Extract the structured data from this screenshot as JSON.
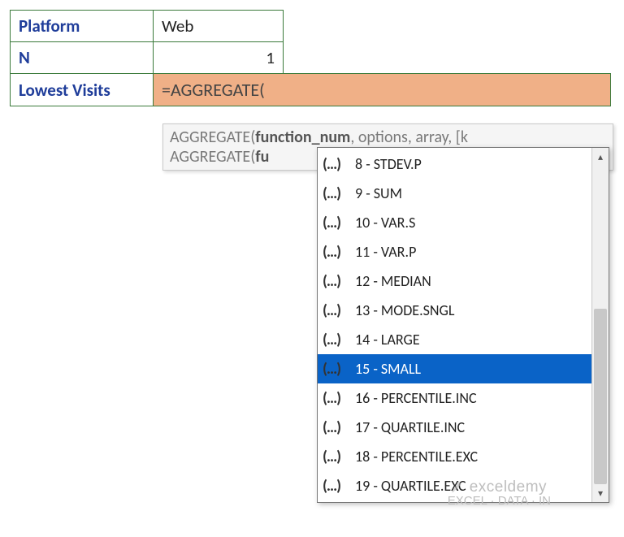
{
  "table": {
    "rows": [
      {
        "label": "Platform",
        "value": "Web",
        "align": "left"
      },
      {
        "label": "N",
        "value": "1",
        "align": "right"
      },
      {
        "label": "Lowest Visits",
        "value": "=AGGREGATE(",
        "formula": true
      }
    ]
  },
  "tooltip": {
    "line1_pre": "AGGREGATE(",
    "line1_bold": "function_num",
    "line1_post": ", options, array, [k",
    "line2_pre": "AGGREGATE(",
    "line2_bold": "fu"
  },
  "dropdown": {
    "items": [
      {
        "icon": "(...)",
        "text": "8 - STDEV.P",
        "selected": false
      },
      {
        "icon": "(...)",
        "text": "9 - SUM",
        "selected": false
      },
      {
        "icon": "(...)",
        "text": "10 - VAR.S",
        "selected": false
      },
      {
        "icon": "(...)",
        "text": "11 - VAR.P",
        "selected": false
      },
      {
        "icon": "(...)",
        "text": "12 - MEDIAN",
        "selected": false
      },
      {
        "icon": "(...)",
        "text": "13 - MODE.SNGL",
        "selected": false
      },
      {
        "icon": "(...)",
        "text": "14 - LARGE",
        "selected": false
      },
      {
        "icon": "(...)",
        "text": "15 - SMALL",
        "selected": true
      },
      {
        "icon": "(...)",
        "text": "16 - PERCENTILE.INC",
        "selected": false
      },
      {
        "icon": "(...)",
        "text": "17 - QUARTILE.INC",
        "selected": false
      },
      {
        "icon": "(...)",
        "text": "18 - PERCENTILE.EXC",
        "selected": false
      },
      {
        "icon": "(...)",
        "text": "19 - QUARTILE.EXC",
        "selected": false
      }
    ]
  },
  "watermark": {
    "brand": "exceldemy",
    "tag": "EXCEL · DATA · IN"
  }
}
